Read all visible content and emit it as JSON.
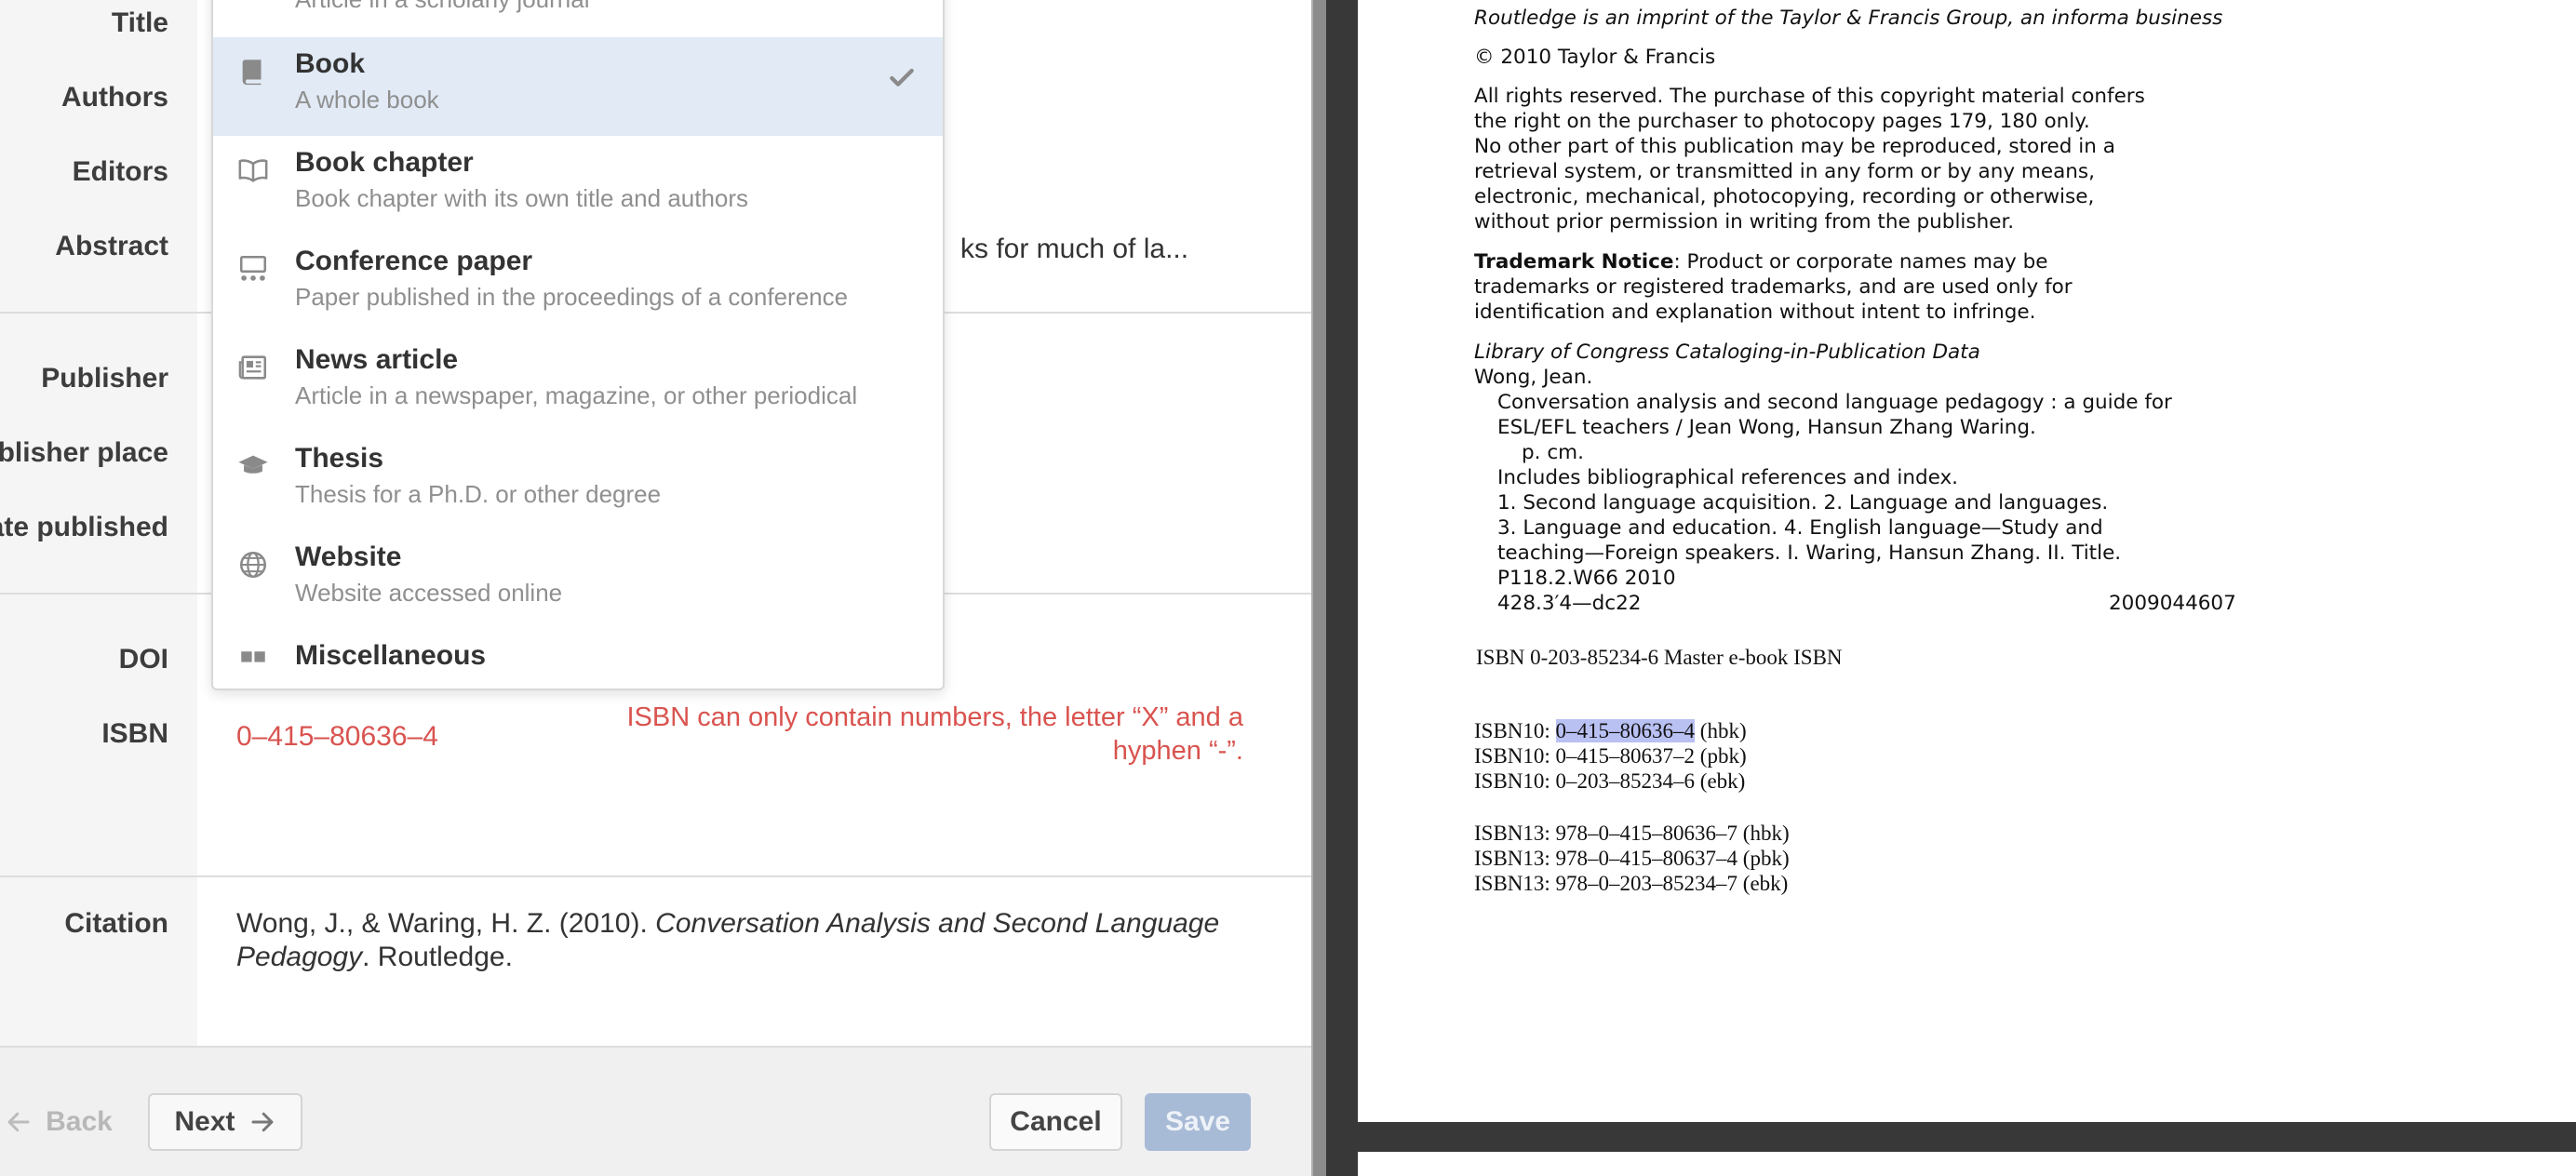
{
  "form": {
    "labels": {
      "title": "Title",
      "authors": "Authors",
      "editors": "Editors",
      "abstract": "Abstract",
      "publisher": "Publisher",
      "publisher_place": "ublisher place",
      "date_published": "ate published",
      "doi": "DOI",
      "isbn": "ISBN",
      "citation": "Citation"
    },
    "abstract_tail": "ks for much of la...",
    "isbn_value": "0–415–80636–4",
    "isbn_error": "ISBN can only contain numbers, the letter “X” and a hyphen “-”.",
    "citation": {
      "prefix": "Wong, J., & Waring, H. Z. (2010). ",
      "title": "Conversation Analysis and Second Language Pedagogy",
      "suffix": ". Routledge."
    },
    "footer": {
      "back": "Back",
      "next": "Next",
      "cancel": "Cancel",
      "save": "Save"
    }
  },
  "dropdown": {
    "partial_top_sub": "Article in a scholarly journal",
    "items": [
      {
        "title": "Book",
        "subtitle": "A whole book",
        "icon": "book-icon",
        "selected": true
      },
      {
        "title": "Book chapter",
        "subtitle": "Book chapter with its own title and authors",
        "icon": "open-book-icon",
        "selected": false
      },
      {
        "title": "Conference paper",
        "subtitle": "Paper published in the proceedings of a conference",
        "icon": "presentation-icon",
        "selected": false
      },
      {
        "title": "News article",
        "subtitle": "Article in a newspaper, magazine, or other periodical",
        "icon": "newspaper-icon",
        "selected": false
      },
      {
        "title": "Thesis",
        "subtitle": "Thesis for a Ph.D. or other degree",
        "icon": "graduation-cap-icon",
        "selected": false
      },
      {
        "title": "Website",
        "subtitle": "Website accessed online",
        "icon": "globe-icon",
        "selected": false
      },
      {
        "title": "Miscellaneous",
        "subtitle": "",
        "icon": "misc-icon",
        "selected": false
      }
    ]
  },
  "pdf": {
    "line1": "Routledge is an imprint of the Taylor & Francis Group, an informa business",
    "copyright": "© 2010 Taylor & Francis",
    "rights": [
      "All rights reserved. The purchase of this copyright material confers",
      "the right on the purchaser to photocopy pages 179, 180 only.",
      "No other part of this publication may be reproduced, stored in a",
      "retrieval system, or transmitted in any form or by any means,",
      "electronic, mechanical, photocopying, recording or otherwise,",
      "without prior permission in writing from the publisher."
    ],
    "trademark_bold": "Trademark Notice",
    "trademark": [
      ": Product or corporate names may be",
      "trademarks or registered trademarks, and are used only for",
      "identification and explanation without intent to infringe."
    ],
    "loc_header": "Library of Congress Cataloging-in-Publication Data",
    "loc_lines": [
      "Wong, Jean.",
      "Conversation analysis and second language pedagogy : a guide for",
      "ESL/EFL teachers / Jean Wong, Hansun Zhang Waring.",
      "p. cm.",
      "Includes bibliographical references and index.",
      "1. Second language acquisition.    2. Language and languages.",
      "3. Language and education.    4. English language—Study and",
      "teaching—Foreign speakers.    I. Waring, Hansun Zhang.    II. Title.",
      "P118.2.W66 2010"
    ],
    "class_number": "428.3′4—dc22",
    "lccn": "2009044607",
    "master_isbn": "ISBN 0-203-85234-6 Master e-book ISBN",
    "isbn10_prefix": "ISBN10: ",
    "isbn10_highlight": "0–415–80636–4",
    "isbn10_hbk_suffix": " (hbk)",
    "isbn_lines": [
      "ISBN10: 0–415–80637–2 (pbk)",
      "ISBN10: 0–203–85234–6 (ebk)",
      "ISBN13: 978–0–415–80636–7 (hbk)",
      "ISBN13: 978–0–415–80637–4 (pbk)",
      "ISBN13: 978–0–203–85234–7 (ebk)"
    ]
  },
  "colors": {
    "error": "#d9534f",
    "selected_row": "#e1eaf5",
    "save_disabled": "#a7bad6",
    "highlight": "#b9c0f2"
  }
}
